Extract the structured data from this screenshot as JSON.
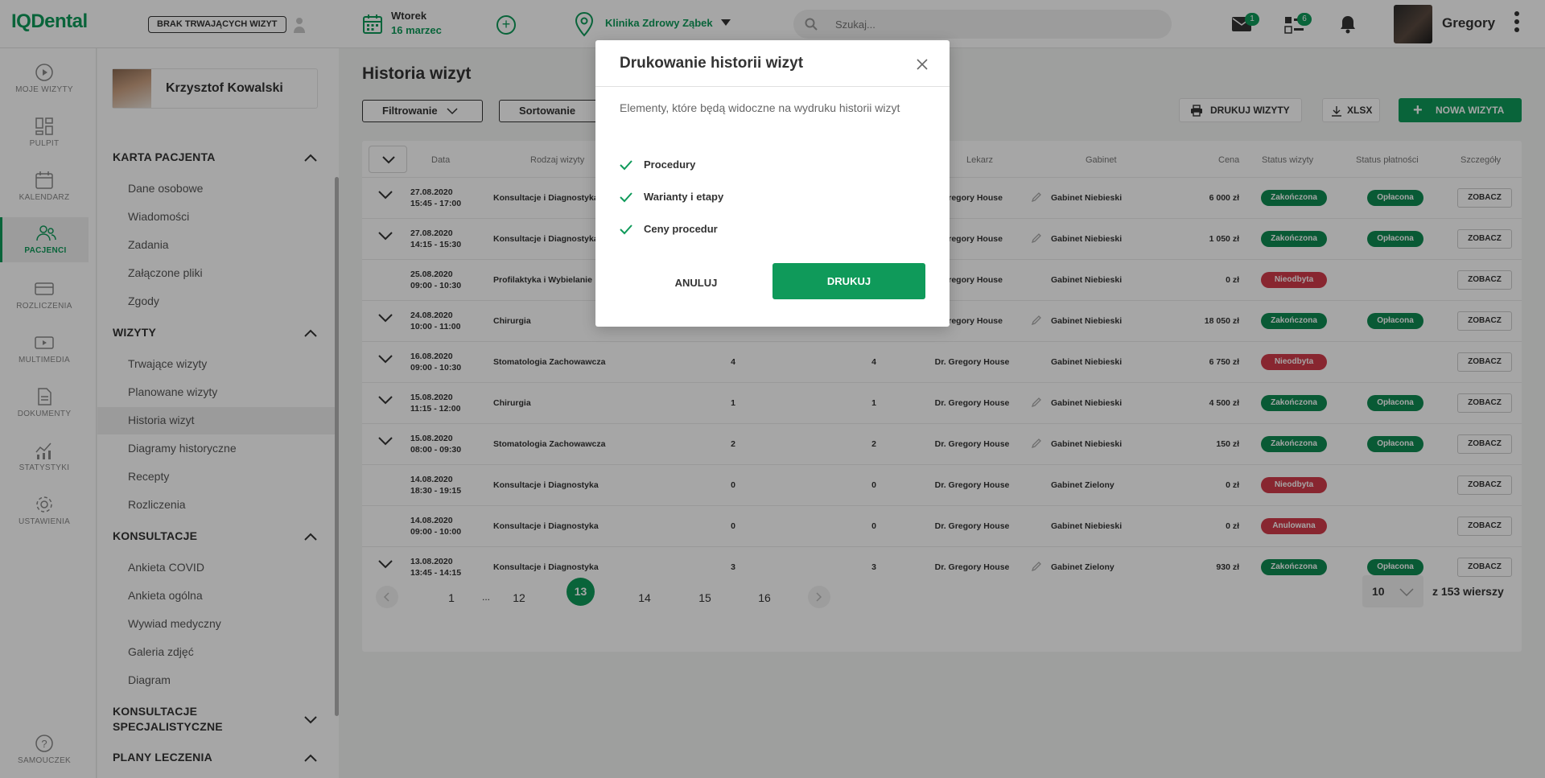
{
  "app": {
    "logo": "IQDental"
  },
  "topbar": {
    "no_visits_label": "BRAK TRWAJĄCYCH WIZYT",
    "date_day": "Wtorek",
    "date_date": "16 marzec",
    "clinic": "Klinika Zdrowy Ząbek",
    "search_placeholder": "Szukaj...",
    "mail_count": "1",
    "tasks_count": "6",
    "user_name": "Gregory"
  },
  "leftnav": {
    "items": [
      {
        "label": "MOJE WIZYTY",
        "icon": "play-circle-icon"
      },
      {
        "label": "PULPIT",
        "icon": "dashboard-icon"
      },
      {
        "label": "KALENDARZ",
        "icon": "calendar-icon"
      },
      {
        "label": "PACJENCI",
        "icon": "patients-icon",
        "active": true
      },
      {
        "label": "ROZLICZENIA",
        "icon": "card-icon"
      },
      {
        "label": "MULTIMEDIA",
        "icon": "media-icon"
      },
      {
        "label": "DOKUMENTY",
        "icon": "document-icon"
      },
      {
        "label": "STATYSTYKI",
        "icon": "chart-icon"
      },
      {
        "label": "USTAWIENIA",
        "icon": "gear-icon"
      }
    ],
    "help_label": "SAMOUCZEK"
  },
  "patient_panel": {
    "patient_name": "Krzysztof Kowalski",
    "sections": [
      {
        "title": "KARTA PACJENTA",
        "items": [
          "Dane osobowe",
          "Wiadomości",
          "Zadania",
          "Załączone pliki",
          "Zgody"
        ]
      },
      {
        "title": "WIZYTY",
        "items": [
          "Trwające wizyty",
          "Planowane wizyty",
          "Historia wizyt",
          "Diagramy historyczne",
          "Recepty",
          "Rozliczenia"
        ]
      },
      {
        "title": "KONSULTACJE",
        "items": [
          "Ankieta COVID",
          "Ankieta ogólna",
          "Wywiad medyczny",
          "Galeria zdjęć",
          "Diagram"
        ]
      },
      {
        "title_line1": "KONSULTACJE",
        "title_line2": "SPECJALISTYCZNE"
      },
      {
        "title": "PLANY LECZENIA"
      }
    ]
  },
  "main": {
    "title": "Historia wizyt",
    "filter_label": "Filtrowanie",
    "sort_label": "Sortowanie",
    "print_visits_label": "DRUKUJ WIZYTY",
    "xlsx_label": "XLSX",
    "new_visit_label": "NOWA WIZYTA",
    "columns": {
      "date": "Data",
      "type": "Rodzaj wizyty",
      "doctor": "Lekarz",
      "office": "Gabinet",
      "price": "Cena",
      "visit_status": "Status wizyty",
      "payment_status": "Status płatności",
      "details": "Szczegóły"
    },
    "rows": [
      {
        "date": "27.08.2020",
        "time": "15:45 - 17:00",
        "type": "Konsultacje i Diagnostyka",
        "n1": "",
        "n2": "",
        "doctor": "Gregory House",
        "office": "Gabinet Niebieski",
        "price": "6 000 zł",
        "status": "Zakończona",
        "payment": "Opłacona",
        "details": "ZOBACZ"
      },
      {
        "date": "27.08.2020",
        "time": "14:15 - 15:30",
        "type": "Konsultacje i Diagnostyka",
        "n1": "",
        "n2": "",
        "doctor": "Gregory House",
        "office": "Gabinet Niebieski",
        "price": "1 050 zł",
        "status": "Zakończona",
        "payment": "Opłacona",
        "details": "ZOBACZ"
      },
      {
        "date": "25.08.2020",
        "time": "09:00 - 10:30",
        "type": "Profilaktyka i Wybielanie",
        "n1": "",
        "n2": "",
        "doctor": "Gregory House",
        "office": "Gabinet Niebieski",
        "price": "0 zł",
        "status": "Nieodbyta",
        "payment": "",
        "details": "ZOBACZ"
      },
      {
        "date": "24.08.2020",
        "time": "10:00 - 11:00",
        "type": "Chirurgia",
        "n1": "",
        "n2": "",
        "doctor": "Gregory House",
        "office": "Gabinet Niebieski",
        "price": "18 050 zł",
        "status": "Zakończona",
        "payment": "Opłacona",
        "details": "ZOBACZ"
      },
      {
        "date": "16.08.2020",
        "time": "09:00 - 10:30",
        "type": "Stomatologia Zachowawcza",
        "n1": "4",
        "n2": "4",
        "doctor": "Dr. Gregory House",
        "office": "Gabinet Niebieski",
        "price": "6 750 zł",
        "status": "Nieodbyta",
        "payment": "",
        "details": "ZOBACZ"
      },
      {
        "date": "15.08.2020",
        "time": "11:15 - 12:00",
        "type": "Chirurgia",
        "n1": "1",
        "n2": "1",
        "doctor": "Dr. Gregory House",
        "office": "Gabinet Niebieski",
        "price": "4 500 zł",
        "status": "Zakończona",
        "payment": "Opłacona",
        "details": "ZOBACZ"
      },
      {
        "date": "15.08.2020",
        "time": "08:00 - 09:30",
        "type": "Stomatologia Zachowawcza",
        "n1": "2",
        "n2": "2",
        "doctor": "Dr. Gregory House",
        "office": "Gabinet Niebieski",
        "price": "150 zł",
        "status": "Zakończona",
        "payment": "Opłacona",
        "details": "ZOBACZ"
      },
      {
        "date": "14.08.2020",
        "time": "18:30 - 19:15",
        "type": "Konsultacje i Diagnostyka",
        "n1": "0",
        "n2": "0",
        "doctor": "Dr. Gregory House",
        "office": "Gabinet Zielony",
        "price": "0 zł",
        "status": "Nieodbyta",
        "payment": "",
        "details": "ZOBACZ"
      },
      {
        "date": "14.08.2020",
        "time": "09:00 - 10:00",
        "type": "Konsultacje i Diagnostyka",
        "n1": "0",
        "n2": "0",
        "doctor": "Dr. Gregory House",
        "office": "Gabinet Niebieski",
        "price": "0 zł",
        "status": "Anulowana",
        "payment": "",
        "details": "ZOBACZ"
      },
      {
        "date": "13.08.2020",
        "time": "13:45 - 14:15",
        "type": "Konsultacje i Diagnostyka",
        "n1": "3",
        "n2": "3",
        "doctor": "Dr. Gregory House",
        "office": "Gabinet Zielony",
        "price": "930 zł",
        "status": "Zakończona",
        "payment": "Opłacona",
        "details": "ZOBACZ"
      }
    ],
    "pager": {
      "pages": [
        "1",
        "...",
        "12",
        "13",
        "14",
        "15",
        "16"
      ],
      "current": "13",
      "per_page": "10",
      "total": "z 153 wierszy"
    }
  },
  "modal": {
    "title": "Drukowanie historii wizyt",
    "description": "Elementy, które będą widoczne na wydruku historii wizyt",
    "options": [
      {
        "label": "Procedury",
        "checked": true
      },
      {
        "label": "Warianty i etapy",
        "checked": true
      },
      {
        "label": "Ceny procedur",
        "checked": true
      }
    ],
    "cancel_label": "ANULUJ",
    "print_label": "DRUKUJ"
  },
  "colors": {
    "accent": "#0f9a5a",
    "danger": "#d23b4a"
  }
}
